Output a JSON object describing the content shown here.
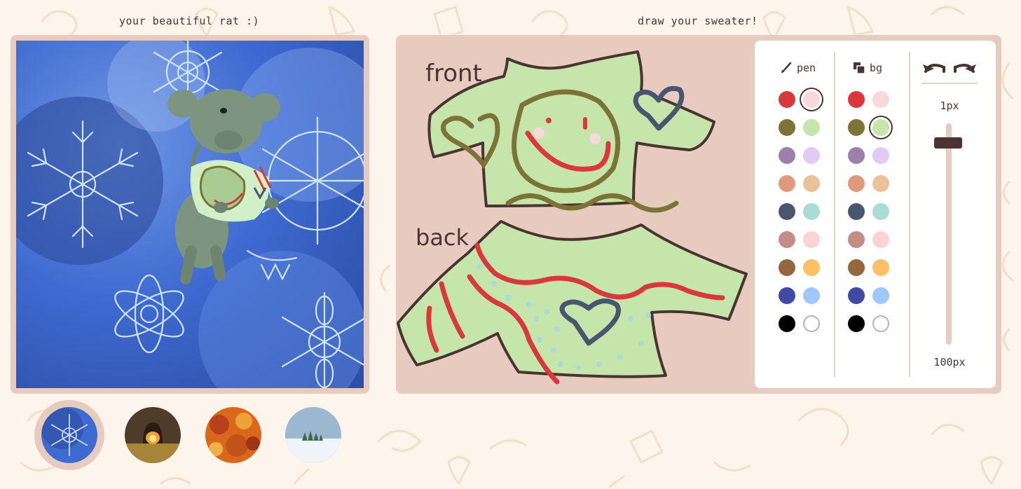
{
  "captions": {
    "rat": "your beautiful rat :)",
    "sweater": "draw your sweater!"
  },
  "sweater": {
    "front_label": "front",
    "back_label": "back"
  },
  "tools": {
    "pen_label": "pen",
    "bg_label": "bg",
    "pen_colors": [
      [
        "#d9393c",
        "#f8d8d8"
      ],
      [
        "#7c7436",
        "#c5e5aa"
      ],
      [
        "#9d7fab",
        "#e2caf7"
      ],
      [
        "#e09a7b",
        "#ebc199"
      ],
      [
        "#4a5670",
        "#a9dcd7"
      ],
      [
        "#c48b87",
        "#fcd3d5"
      ],
      [
        "#93673f",
        "#fdc064"
      ],
      [
        "#404aa2",
        "#a1c8fb"
      ],
      [
        "#000000",
        "#ffffff"
      ]
    ],
    "bg_colors": [
      [
        "#d9393c",
        "#f8d8d8"
      ],
      [
        "#7c7436",
        "#c5e5aa"
      ],
      [
        "#9d7fab",
        "#e2caf7"
      ],
      [
        "#e09a7b",
        "#ebc199"
      ],
      [
        "#4a5670",
        "#a9dcd7"
      ],
      [
        "#c48b87",
        "#fcd3d5"
      ],
      [
        "#93673f",
        "#fdc064"
      ],
      [
        "#404aa2",
        "#a1c8fb"
      ],
      [
        "#000000",
        "#ffffff"
      ]
    ],
    "pen_selected": "#f8d8d8",
    "bg_selected": "#c5e5aa",
    "size_min_label": "1px",
    "size_max_label": "100px",
    "brush_size_fraction": 0.09
  },
  "backgrounds": [
    {
      "name": "snowflakes",
      "selected": true
    },
    {
      "name": "fireplace",
      "selected": false
    },
    {
      "name": "autumn-leaves",
      "selected": false
    },
    {
      "name": "snowy-trees",
      "selected": false
    }
  ],
  "colors": {
    "page_bg": "#fdf4ec",
    "frame": "#e8cbbf",
    "ink": "#4a3432",
    "sweater_fill": "#c5e5aa"
  }
}
